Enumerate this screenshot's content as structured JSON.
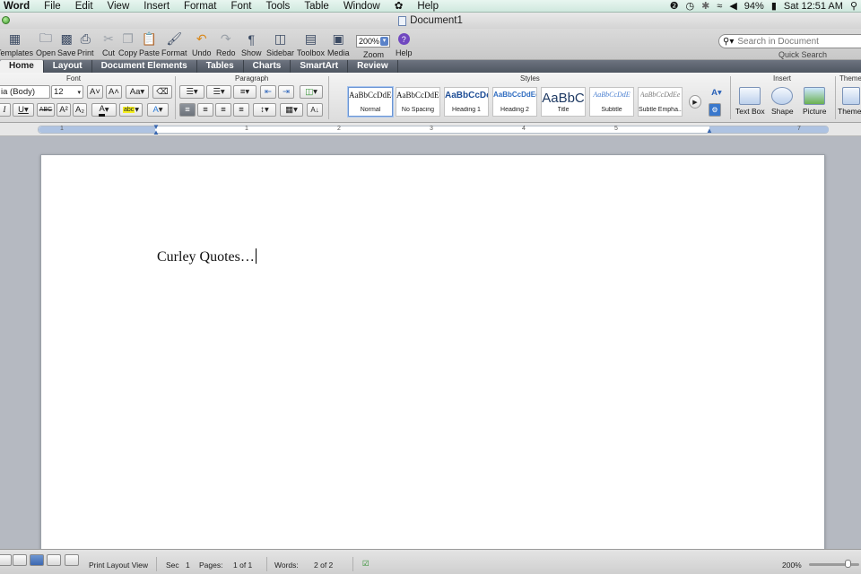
{
  "menubar": {
    "app": "Word",
    "items": [
      "File",
      "Edit",
      "View",
      "Insert",
      "Format",
      "Font",
      "Tools",
      "Table",
      "Window",
      "Help"
    ],
    "battery": "94%",
    "clock": "Sat 12:51 AM"
  },
  "titlebar": {
    "title": "Document1"
  },
  "toolbar": {
    "buttons": [
      "Templates",
      "Open",
      "Save",
      "Print",
      "Cut",
      "Copy",
      "Paste",
      "Format",
      "Undo",
      "Redo",
      "Show",
      "Sidebar",
      "Toolbox",
      "Media",
      "Zoom",
      "Help"
    ],
    "zoom_value": "200%",
    "search_placeholder": "Search in Document",
    "quick_search": "Quick Search"
  },
  "tabs": [
    "Home",
    "Layout",
    "Document Elements",
    "Tables",
    "Charts",
    "SmartArt",
    "Review"
  ],
  "ribbon": {
    "groups": {
      "font": "Font",
      "paragraph": "Paragraph",
      "styles": "Styles",
      "insert": "Insert",
      "themes": "Themes"
    },
    "font_name": "ia (Body)",
    "font_size": "12",
    "styles": [
      {
        "preview": "AaBbCcDdEe",
        "name": "Normal"
      },
      {
        "preview": "AaBbCcDdEe",
        "name": "No Spacing"
      },
      {
        "preview": "AaBbCcDc",
        "name": "Heading 1"
      },
      {
        "preview": "AaBbCcDdEe",
        "name": "Heading 2"
      },
      {
        "preview": "AaBbC",
        "name": "Title"
      },
      {
        "preview": "AaBbCcDdE",
        "name": "Subtitle"
      },
      {
        "preview": "AaBbCcDdEe",
        "name": "Subtle Empha..."
      }
    ],
    "insert": [
      "Text Box",
      "Shape",
      "Picture"
    ],
    "themes_label": "Themes"
  },
  "ruler": {
    "numbers": [
      "1",
      "1",
      "2",
      "3",
      "4",
      "5",
      "7"
    ]
  },
  "document": {
    "text": "Curley Quotes…"
  },
  "statusbar": {
    "view": "Print Layout View",
    "sec_label": "Sec",
    "sec_value": "1",
    "pages_label": "Pages:",
    "pages_value": "1 of 1",
    "words_label": "Words:",
    "words_value": "2 of 2",
    "zoom": "200%"
  },
  "colors": {
    "accent": "#5a82c8",
    "menubar_bg": "#d8efe6",
    "tab_bar": "#5c636d",
    "page": "#ffffff",
    "workspace": "#b5b9c1"
  }
}
